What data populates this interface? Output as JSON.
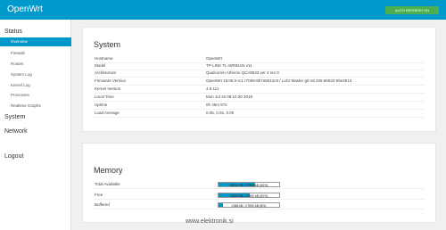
{
  "app": {
    "brand": "OpenWrt",
    "auto_refresh": "AUTO REFRESH ON"
  },
  "sidebar": {
    "status_label": "Status",
    "sub_items": [
      {
        "label": "Overview",
        "active": true
      },
      {
        "label": "Firewall"
      },
      {
        "label": "Routes"
      },
      {
        "label": "System Log"
      },
      {
        "label": "Kernel Log"
      },
      {
        "label": "Processes"
      },
      {
        "label": "Realtime Graphs"
      }
    ],
    "system_label": "System",
    "network_label": "Network",
    "logout_label": "Logout"
  },
  "system": {
    "title": "System",
    "rows": [
      {
        "key": "Hostname",
        "value": "OpenWrt"
      },
      {
        "key": "Model",
        "value": "TP-LINK TL-WR841N v11"
      },
      {
        "key": "Architecture",
        "value": "Qualcomm Atheros QCA9533 ver 2 rev 0"
      },
      {
        "key": "Firmware Version",
        "value": "OpenWrt 18.06.0-rc1 r7058-8b7a5512c8 / LuCI Master git-18.226.66522-55e4513"
      },
      {
        "key": "Kernel Version",
        "value": "4.9.111"
      },
      {
        "key": "Local Time",
        "value": "Mon Jul 16 08:10:30 2018"
      },
      {
        "key": "Uptime",
        "value": "0h 46m 57s"
      },
      {
        "key": "Load Average",
        "value": "0.05, 0.02, 0.00"
      }
    ]
  },
  "memory": {
    "title": "Memory",
    "rows": [
      {
        "key": "Total Available",
        "text": "16912 kB / 27892 kB (60%)",
        "percent": 60
      },
      {
        "key": "Free",
        "text": "14524 kB / 27892 kB (52%)",
        "percent": 52
      },
      {
        "key": "Buffered",
        "text": "2388 kB / 27892 kB (8%)",
        "percent": 8
      }
    ]
  },
  "watermark": "www.elektronik.si",
  "colors": {
    "accent": "#0099cc",
    "auto_refresh": "#4caf50",
    "background": "#f0f0f0"
  }
}
